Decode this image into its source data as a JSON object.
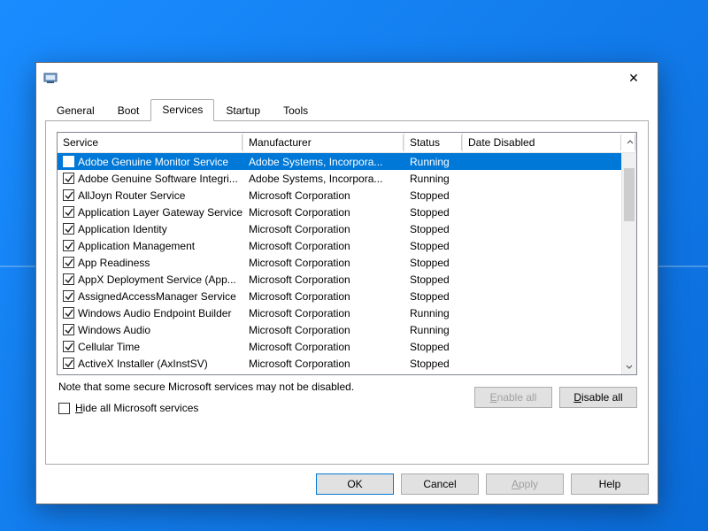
{
  "window": {
    "close_tooltip": "Close"
  },
  "tabs": {
    "general": "General",
    "boot": "Boot",
    "services": "Services",
    "startup": "Startup",
    "tools": "Tools",
    "active": "services"
  },
  "columns": {
    "service": "Service",
    "manufacturer": "Manufacturer",
    "status": "Status",
    "date_disabled": "Date Disabled"
  },
  "services": [
    {
      "checked": true,
      "selected": true,
      "name": "Adobe Genuine Monitor Service",
      "mfr": "Adobe Systems, Incorpora...",
      "status": "Running",
      "date": ""
    },
    {
      "checked": true,
      "selected": false,
      "name": "Adobe Genuine Software Integri...",
      "mfr": "Adobe Systems, Incorpora...",
      "status": "Running",
      "date": ""
    },
    {
      "checked": true,
      "selected": false,
      "name": "AllJoyn Router Service",
      "mfr": "Microsoft Corporation",
      "status": "Stopped",
      "date": ""
    },
    {
      "checked": true,
      "selected": false,
      "name": "Application Layer Gateway Service",
      "mfr": "Microsoft Corporation",
      "status": "Stopped",
      "date": ""
    },
    {
      "checked": true,
      "selected": false,
      "name": "Application Identity",
      "mfr": "Microsoft Corporation",
      "status": "Stopped",
      "date": ""
    },
    {
      "checked": true,
      "selected": false,
      "name": "Application Management",
      "mfr": "Microsoft Corporation",
      "status": "Stopped",
      "date": ""
    },
    {
      "checked": true,
      "selected": false,
      "name": "App Readiness",
      "mfr": "Microsoft Corporation",
      "status": "Stopped",
      "date": ""
    },
    {
      "checked": true,
      "selected": false,
      "name": "AppX Deployment Service (App...",
      "mfr": "Microsoft Corporation",
      "status": "Stopped",
      "date": ""
    },
    {
      "checked": true,
      "selected": false,
      "name": "AssignedAccessManager Service",
      "mfr": "Microsoft Corporation",
      "status": "Stopped",
      "date": ""
    },
    {
      "checked": true,
      "selected": false,
      "name": "Windows Audio Endpoint Builder",
      "mfr": "Microsoft Corporation",
      "status": "Running",
      "date": ""
    },
    {
      "checked": true,
      "selected": false,
      "name": "Windows Audio",
      "mfr": "Microsoft Corporation",
      "status": "Running",
      "date": ""
    },
    {
      "checked": true,
      "selected": false,
      "name": "Cellular Time",
      "mfr": "Microsoft Corporation",
      "status": "Stopped",
      "date": ""
    },
    {
      "checked": true,
      "selected": false,
      "name": "ActiveX Installer (AxInstSV)",
      "mfr": "Microsoft Corporation",
      "status": "Stopped",
      "date": ""
    }
  ],
  "note": "Note that some secure Microsoft services may not be disabled.",
  "buttons": {
    "enable_all": "Enable all",
    "disable_all": "Disable all",
    "hide_ms": "Hide all Microsoft services",
    "hide_ms_checked": false,
    "ok": "OK",
    "cancel": "Cancel",
    "apply": "Apply",
    "help": "Help"
  }
}
